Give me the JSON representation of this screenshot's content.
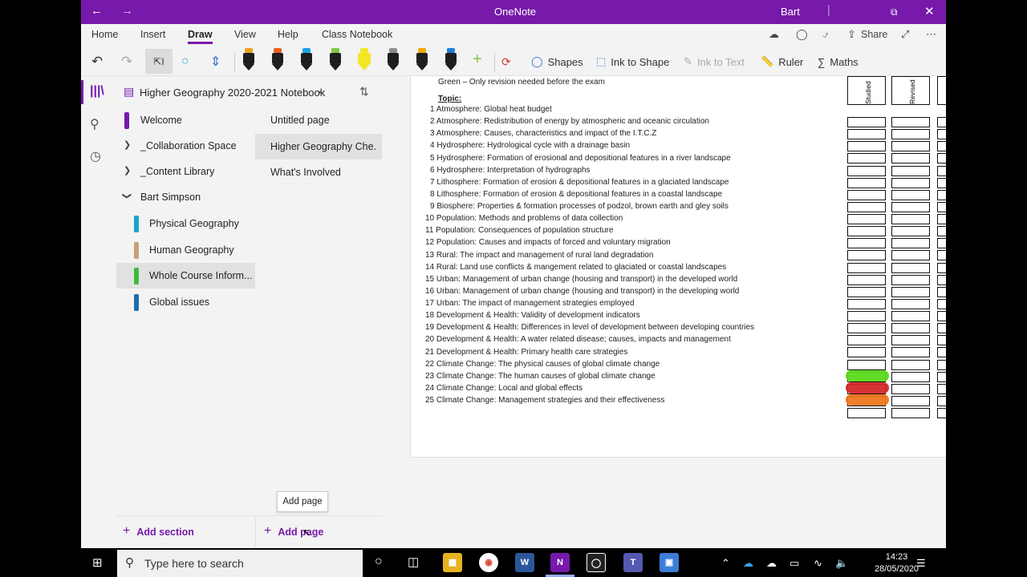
{
  "titlebar": {
    "app": "OneNote",
    "user": "Bart"
  },
  "tabs": [
    "Home",
    "Insert",
    "Draw",
    "View",
    "Help",
    "Class Notebook"
  ],
  "active_tab": "Draw",
  "tab_right": {
    "share": "Share"
  },
  "toolbar": {
    "shapes": "Shapes",
    "ink_to_shape": "Ink to Shape",
    "ink_to_text": "Ink to Text",
    "ruler": "Ruler",
    "maths": "Maths",
    "pen_colors": [
      "#f0a11b",
      "#e85d1f",
      "#1aa3e8",
      "#7ac943",
      "#f5e625",
      "#8c8c8c",
      "#f2a900",
      "#1a7fd6"
    ]
  },
  "notebook": {
    "title": "Higher Geography 2020-2021 Notebook"
  },
  "sections": [
    {
      "label": "Welcome",
      "color": "#7719aa"
    },
    {
      "label": "_Collaboration Space"
    },
    {
      "label": "_Content Library"
    },
    {
      "label": "Bart Simpson"
    },
    {
      "label": "Physical Geography",
      "color": "#1aa3c9"
    },
    {
      "label": "Human Geography",
      "color": "#c8a07a"
    },
    {
      "label": "Whole Course Inform...",
      "color": "#3dbb3d"
    },
    {
      "label": "Global issues",
      "color": "#1a6fb0"
    }
  ],
  "pages": [
    "Untitled page",
    "Higher Geography Che...",
    "What's Involved"
  ],
  "bottom": {
    "add_section": "Add section",
    "add_page": "Add page",
    "tooltip": "Add page"
  },
  "document": {
    "intro": "Green – Only revision needed before the exam",
    "topic_label": "Topic:",
    "topics": [
      "1  Atmosphere: Global heat budget",
      "2  Atmosphere: Redistribution of energy by atmospheric and oceanic circulation",
      "3  Atmosphere: Causes, characteristics and impact of the I.T.C.Z",
      "4  Hydrosphere: Hydrological cycle with a drainage basin",
      "5  Hydrosphere: Formation of erosional and depositional features in a river landscape",
      "6  Hydrosphere: Interpretation of hydrographs",
      "7  Lithosphere: Formation of erosion & depositional features in a glaciated landscape",
      "8  Lithosphere: Formation of erosion & depositional features in a coastal landscape",
      "9  Biosphere: Properties & formation processes of podzol, brown earth and gley soils",
      "10  Population: Methods and problems of data collection",
      "11  Population: Consequences of population structure",
      "12  Population: Causes and impacts of forced and voluntary migration",
      "13  Rural: The impact and management of rural land degradation",
      "14  Rural: Land use conflicts & mangement related to glaciated or coastal landscapes",
      "15  Urban: Management of urban change (housing and transport) in the developed world",
      "16  Urban: Management of urban change (housing and transport) in the developing world",
      "17  Urban: The impact of management strategies employed",
      "18  Development & Health: Validity of development indicators",
      "19  Development & Health: Differences in level of development between developing countries",
      "20  Development & Health: A water related disease; causes, impacts and management",
      "21  Development & Health:  Primary health care strategies",
      "22  Climate Change: The physical causes of  global climate change",
      "23  Climate Change: The human causes of global climate change",
      "24  Climate Change: Local and global effects",
      "25  Climate Change: Management strategies and their effectiveness"
    ],
    "col_headers": [
      "Studied",
      "Revised"
    ],
    "highlights": [
      {
        "row": 22,
        "color": "#56d916"
      },
      {
        "row": 23,
        "color": "#d42424"
      },
      {
        "row": 24,
        "color": "#f07318"
      }
    ]
  },
  "taskbar": {
    "search_placeholder": "Type here to search",
    "time": "14:23",
    "date": "28/05/2020"
  }
}
